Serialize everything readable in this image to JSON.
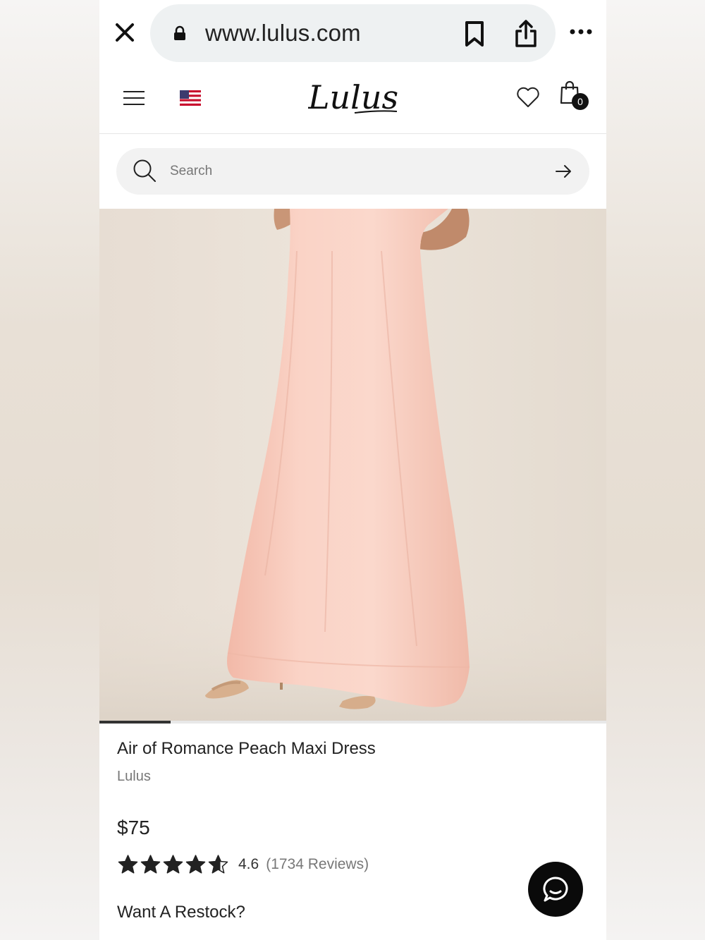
{
  "browser": {
    "url": "www.lulus.com",
    "icons": [
      "close-icon",
      "lock-icon",
      "bookmark-icon",
      "share-icon",
      "more-icon"
    ]
  },
  "header": {
    "brand": "Lulus",
    "cart_count": "0",
    "icons": [
      "hamburger-menu-icon",
      "us-flag-icon",
      "heart-icon",
      "shopping-bag-icon"
    ]
  },
  "search": {
    "placeholder": "Search",
    "icons": [
      "search-icon",
      "arrow-right-icon"
    ]
  },
  "gallery": {
    "current_image_fraction": 0.14
  },
  "product": {
    "title": "Air of Romance Peach Maxi Dress",
    "brand": "Lulus",
    "price": "$75",
    "rating": 4.6,
    "rating_text": "4.6",
    "reviews_text": "(1734 Reviews)",
    "restock_label": "Want A Restock?"
  },
  "chat": {
    "icon": "chat-bubble-icon"
  },
  "colors": {
    "dress": "#f8cbbc",
    "background": "#e7ddd3",
    "accent": "#111111"
  }
}
